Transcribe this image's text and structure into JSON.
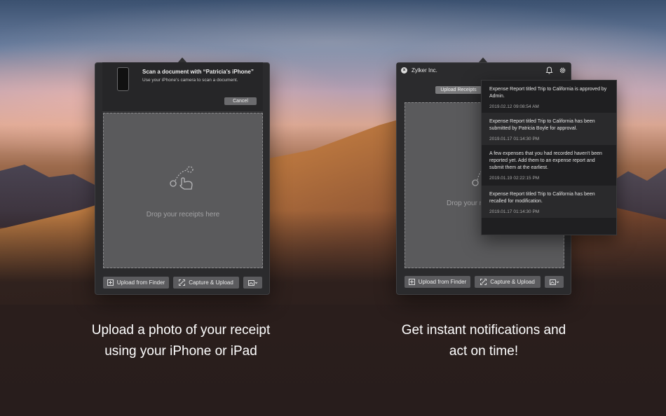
{
  "left_window": {
    "scan_sheet": {
      "title": "Scan a document with “Patricia’s iPhone”",
      "subtitle": "Use your iPhone’s camera to scan a document.",
      "cancel_label": "Cancel"
    },
    "drop_text": "Drop your receipts here",
    "buttons": {
      "upload_finder": "Upload from Finder",
      "capture_upload": "Capture & Upload"
    }
  },
  "right_window": {
    "title": "Zylker Inc.",
    "tab_label": "Upload Receipts",
    "drop_text": "Drop your r",
    "buttons": {
      "upload_finder": "Upload from Finder",
      "capture_upload": "Capture & Upload"
    }
  },
  "notifications": [
    {
      "text": "Expense Report titled Trip to California is approved by Admin.",
      "time": "2019.02.12 09:08:54 AM"
    },
    {
      "text": "Expense Report titled Trip to California has been submitted by Patricia Boyle for approval.",
      "time": "2019.01.17 01:14:30 PM"
    },
    {
      "text": "A few expenses that you had recorded haven't been reported yet. Add them to an expense report and submit them at the earliest.",
      "time": "2019.01.19 02:22:15 PM"
    },
    {
      "text": "Expense Report titled Trip to California has been recalled for modification.",
      "time": "2019.01.17 01:14:30 PM"
    }
  ],
  "captions": {
    "left_line1": "Upload a photo of your receipt",
    "left_line2": "using your iPhone or iPad",
    "right_line1": "Get instant notifications and",
    "right_line2": "act on time!"
  },
  "icons": {
    "drag": "drag-gesture-icon",
    "upload": "upload-file-icon",
    "capture": "capture-frame-icon",
    "image_menu": "image-menu-icon",
    "bell": "bell-icon",
    "gear": "gear-icon",
    "close": "close-icon"
  }
}
